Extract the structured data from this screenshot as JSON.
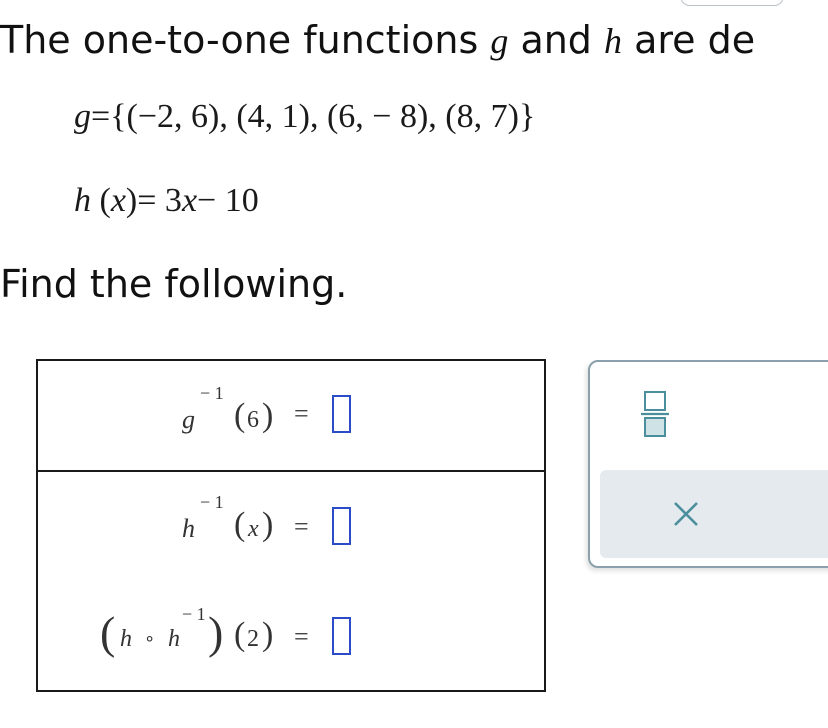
{
  "intro": {
    "text_before": "The one-to-one functions ",
    "g_symbol": "g",
    "and_text": " and ",
    "h_symbol": "h",
    "text_after": " are de"
  },
  "definitions": {
    "g_name": "g",
    "g_eq": "=",
    "g_open": "{(",
    "g_set": "−2,  6),  (4,  1),  (6,  − 8),  (8,  7)",
    "g_close": "}",
    "h_name": "h",
    "h_arg": "x",
    "h_rhs": "= 3",
    "h_var": "x",
    "h_tail": "− 10"
  },
  "prompt": "Find the following.",
  "rows": [
    {
      "fn": "g",
      "exponent": "− 1",
      "arg": "6",
      "equals": "="
    },
    {
      "fn": "h",
      "exponent": "− 1",
      "arg": "x",
      "equals": "="
    },
    {
      "outer_fn": "h",
      "compose": "∘",
      "inner_fn": "h",
      "exponent": "− 1",
      "arg": "2",
      "equals": "="
    }
  ],
  "keypad": {
    "fraction_icon": "fraction-template-icon",
    "clear_icon": "close-icon",
    "clear_symbol": "×",
    "colors": {
      "icon": "#4c8f9c",
      "fraction_fill": "#cfe3e7",
      "panel": "#e4eaee",
      "answer_box": "#2b4bc8"
    }
  }
}
